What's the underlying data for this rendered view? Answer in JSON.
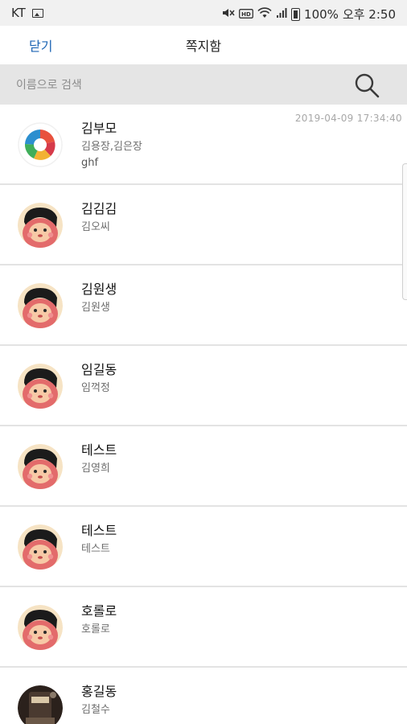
{
  "status_bar": {
    "carrier": "KT",
    "battery": "100%",
    "time": "오후 2:50",
    "icons": [
      "image-icon",
      "mute-icon",
      "volte-icon",
      "wifi-icon",
      "signal-icon",
      "battery-icon"
    ]
  },
  "header": {
    "close_label": "닫기",
    "title": "쪽지함"
  },
  "search": {
    "placeholder": "이름으로 검색"
  },
  "colors": {
    "accent": "#1e66b4",
    "search_bg": "#e5e5e5",
    "divider": "#e3e3e3"
  },
  "messages": [
    {
      "name": "김부모",
      "sub": "김용장,김은장",
      "message": "ghf",
      "time": "2019-04-09 17:34:40",
      "avatar": "app-logo-avatar"
    },
    {
      "name": "김김김",
      "sub": "김오씨",
      "avatar": "monkey-avatar"
    },
    {
      "name": "김원생",
      "sub": "김원생",
      "avatar": "monkey-avatar"
    },
    {
      "name": "임길동",
      "sub": "임꺽정",
      "avatar": "monkey-avatar"
    },
    {
      "name": "테스트",
      "sub": "김영희",
      "avatar": "monkey-avatar"
    },
    {
      "name": "테스트",
      "sub": "테스트",
      "avatar": "monkey-avatar"
    },
    {
      "name": "호롤로",
      "sub": "호롤로",
      "avatar": "monkey-avatar"
    },
    {
      "name": "홍길동",
      "sub": "김철수",
      "avatar": "photo-avatar"
    }
  ]
}
